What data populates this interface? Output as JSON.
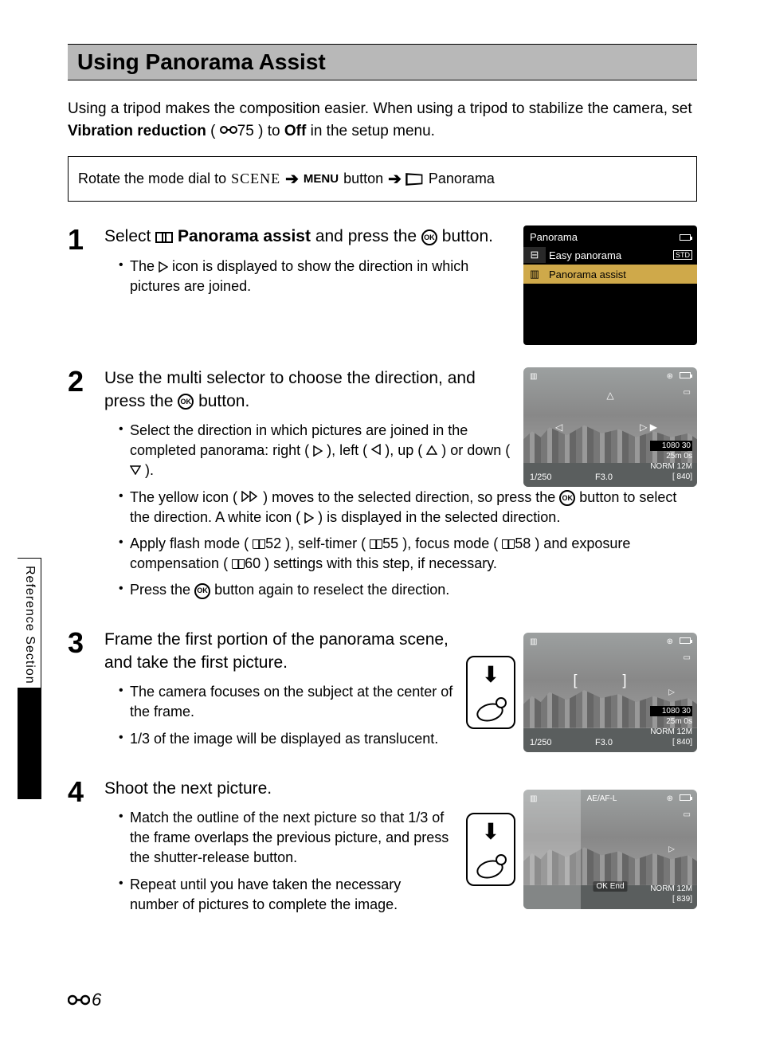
{
  "sidebar_label": "Reference Section",
  "section_title": "Using Panorama Assist",
  "intro_pre": "Using a tripod makes the composition easier. When using a tripod to stabilize the camera, set ",
  "intro_bold1": "Vibration reduction",
  "intro_mid": " (",
  "intro_ref": "75",
  "intro_mid2": ") to ",
  "intro_bold2": "Off",
  "intro_end": " in the setup menu.",
  "route": {
    "pre": "Rotate the mode dial to ",
    "scene": "SCENE",
    "menu": "MENU",
    "btn": " button ",
    "pan": " Panorama"
  },
  "steps": {
    "s1": {
      "num": "1",
      "title_pre": "Select ",
      "title_bold": "Panorama assist",
      "title_mid": " and press the ",
      "title_end": " button.",
      "b1_pre": "The ",
      "b1_end": " icon is displayed to show the direction in which pictures are joined."
    },
    "s2": {
      "num": "2",
      "title_pre": "Use the multi selector to choose the direction, and press the ",
      "title_end": " button.",
      "b1_pre": "Select the direction in which pictures are joined in the completed panorama: right (",
      "b1_m1": "), left (",
      "b1_m2": "), up (",
      "b1_m3": ") or down (",
      "b1_end": ").",
      "b2_pre": "The yellow icon (",
      "b2_mid": ") moves to the selected direction, so press the ",
      "b2_mid2": " button to select the direction. A white icon (",
      "b2_end": ") is displayed in the selected direction.",
      "b3_pre": "Apply flash mode (",
      "b3_r1": "52",
      "b3_m1": "), self-timer (",
      "b3_r2": "55",
      "b3_m2": "), focus mode (",
      "b3_r3": "58",
      "b3_m3": ") and exposure compensation (",
      "b3_r4": "60",
      "b3_end": ") settings with this step, if necessary.",
      "b4_pre": "Press the ",
      "b4_end": " button again to reselect the direction."
    },
    "s3": {
      "num": "3",
      "title": "Frame the first portion of the panorama scene, and take the first picture.",
      "b1": "The camera focuses on the subject at the center of the frame.",
      "b2": "1/3 of the image will be displayed as translucent."
    },
    "s4": {
      "num": "4",
      "title": "Shoot the next picture.",
      "b1": "Match the outline of the next picture so that 1/3 of the frame overlaps the previous picture, and press the shutter-release button.",
      "b2": "Repeat until you have taken the necessary number of pictures to complete the image."
    }
  },
  "menu_screen": {
    "title": "Panorama",
    "row1": "Easy panorama",
    "row1_badge": "STD",
    "row2": "Panorama assist"
  },
  "lcd": {
    "shutter": "1/250",
    "fstop": "F3.0",
    "res": "1080 30",
    "time": "25m 0s",
    "norm": "NORM 12M",
    "count1": "[  840]",
    "count2": "[  839]",
    "ae": "AE/AF-L",
    "end": "OK End"
  },
  "page_number": "6"
}
